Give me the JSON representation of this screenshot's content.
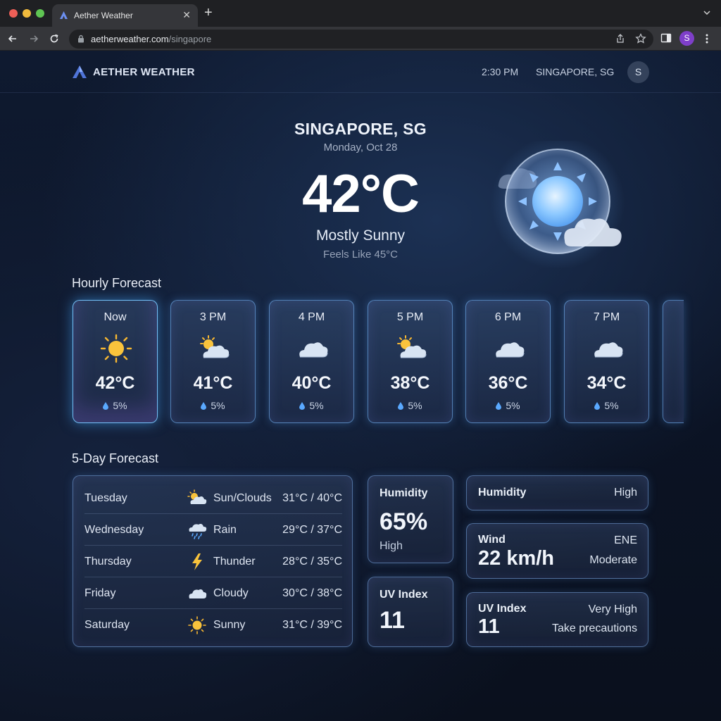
{
  "browser": {
    "tab_title": "Aether Weather",
    "url_host": "aetherweather.com",
    "url_path": "/singapore",
    "profile_initial": "S"
  },
  "header": {
    "brand": "AETHER WEATHER",
    "time": "2:30 PM",
    "location": "SINGAPORE, SG",
    "avatar_initial": "S"
  },
  "current": {
    "city": "SINGAPORE, SG",
    "date": "Monday, Oct 28",
    "temp": "42°C",
    "condition": "Mostly Sunny",
    "feels_like": "Feels Like 45°C",
    "icon": "sun-cloud-orb-icon"
  },
  "hourly": {
    "title": "Hourly Forecast",
    "items": [
      {
        "time": "Now",
        "icon": "sun-icon",
        "temp": "42°C",
        "precip": "5%"
      },
      {
        "time": "3 PM",
        "icon": "partly-cloudy-icon",
        "temp": "41°C",
        "precip": "5%"
      },
      {
        "time": "4 PM",
        "icon": "cloud-icon",
        "temp": "40°C",
        "precip": "5%"
      },
      {
        "time": "5 PM",
        "icon": "partly-cloudy-icon",
        "temp": "38°C",
        "precip": "5%"
      },
      {
        "time": "6 PM",
        "icon": "cloud-icon",
        "temp": "36°C",
        "precip": "5%"
      },
      {
        "time": "7 PM",
        "icon": "cloud-icon",
        "temp": "34°C",
        "precip": "5%"
      }
    ]
  },
  "daily": {
    "title": "5-Day Forecast",
    "days": [
      {
        "day": "Tuesday",
        "icon": "partly-cloudy-icon",
        "condition": "Sun/Clouds",
        "range": "31°C / 40°C"
      },
      {
        "day": "Wednesday",
        "icon": "rain-icon",
        "condition": "Rain",
        "range": "29°C / 37°C"
      },
      {
        "day": "Thursday",
        "icon": "lightning-icon",
        "condition": "Thunder",
        "range": "28°C / 35°C"
      },
      {
        "day": "Friday",
        "icon": "cloud-icon",
        "condition": "Cloudy",
        "range": "30°C / 38°C"
      },
      {
        "day": "Saturday",
        "icon": "sun-icon",
        "condition": "Sunny",
        "range": "31°C / 39°C"
      }
    ]
  },
  "metrics": {
    "humidity_card": {
      "title": "Humidity",
      "value": "65%",
      "level": "High"
    },
    "uv_card": {
      "title": "UV Index",
      "value": "11"
    },
    "humidity_row": {
      "title": "Humidity",
      "level": "High"
    },
    "wind_row": {
      "title": "Wind",
      "value": "22 km/h",
      "direction": "ENE",
      "level": "Moderate"
    },
    "uv_row": {
      "title": "UV Index",
      "value": "11",
      "level": "Very High",
      "advice": "Take precautions"
    }
  },
  "colors": {
    "sun": "#f7b731",
    "accent": "#5aa9ff",
    "card_border": "#78a5e1"
  }
}
